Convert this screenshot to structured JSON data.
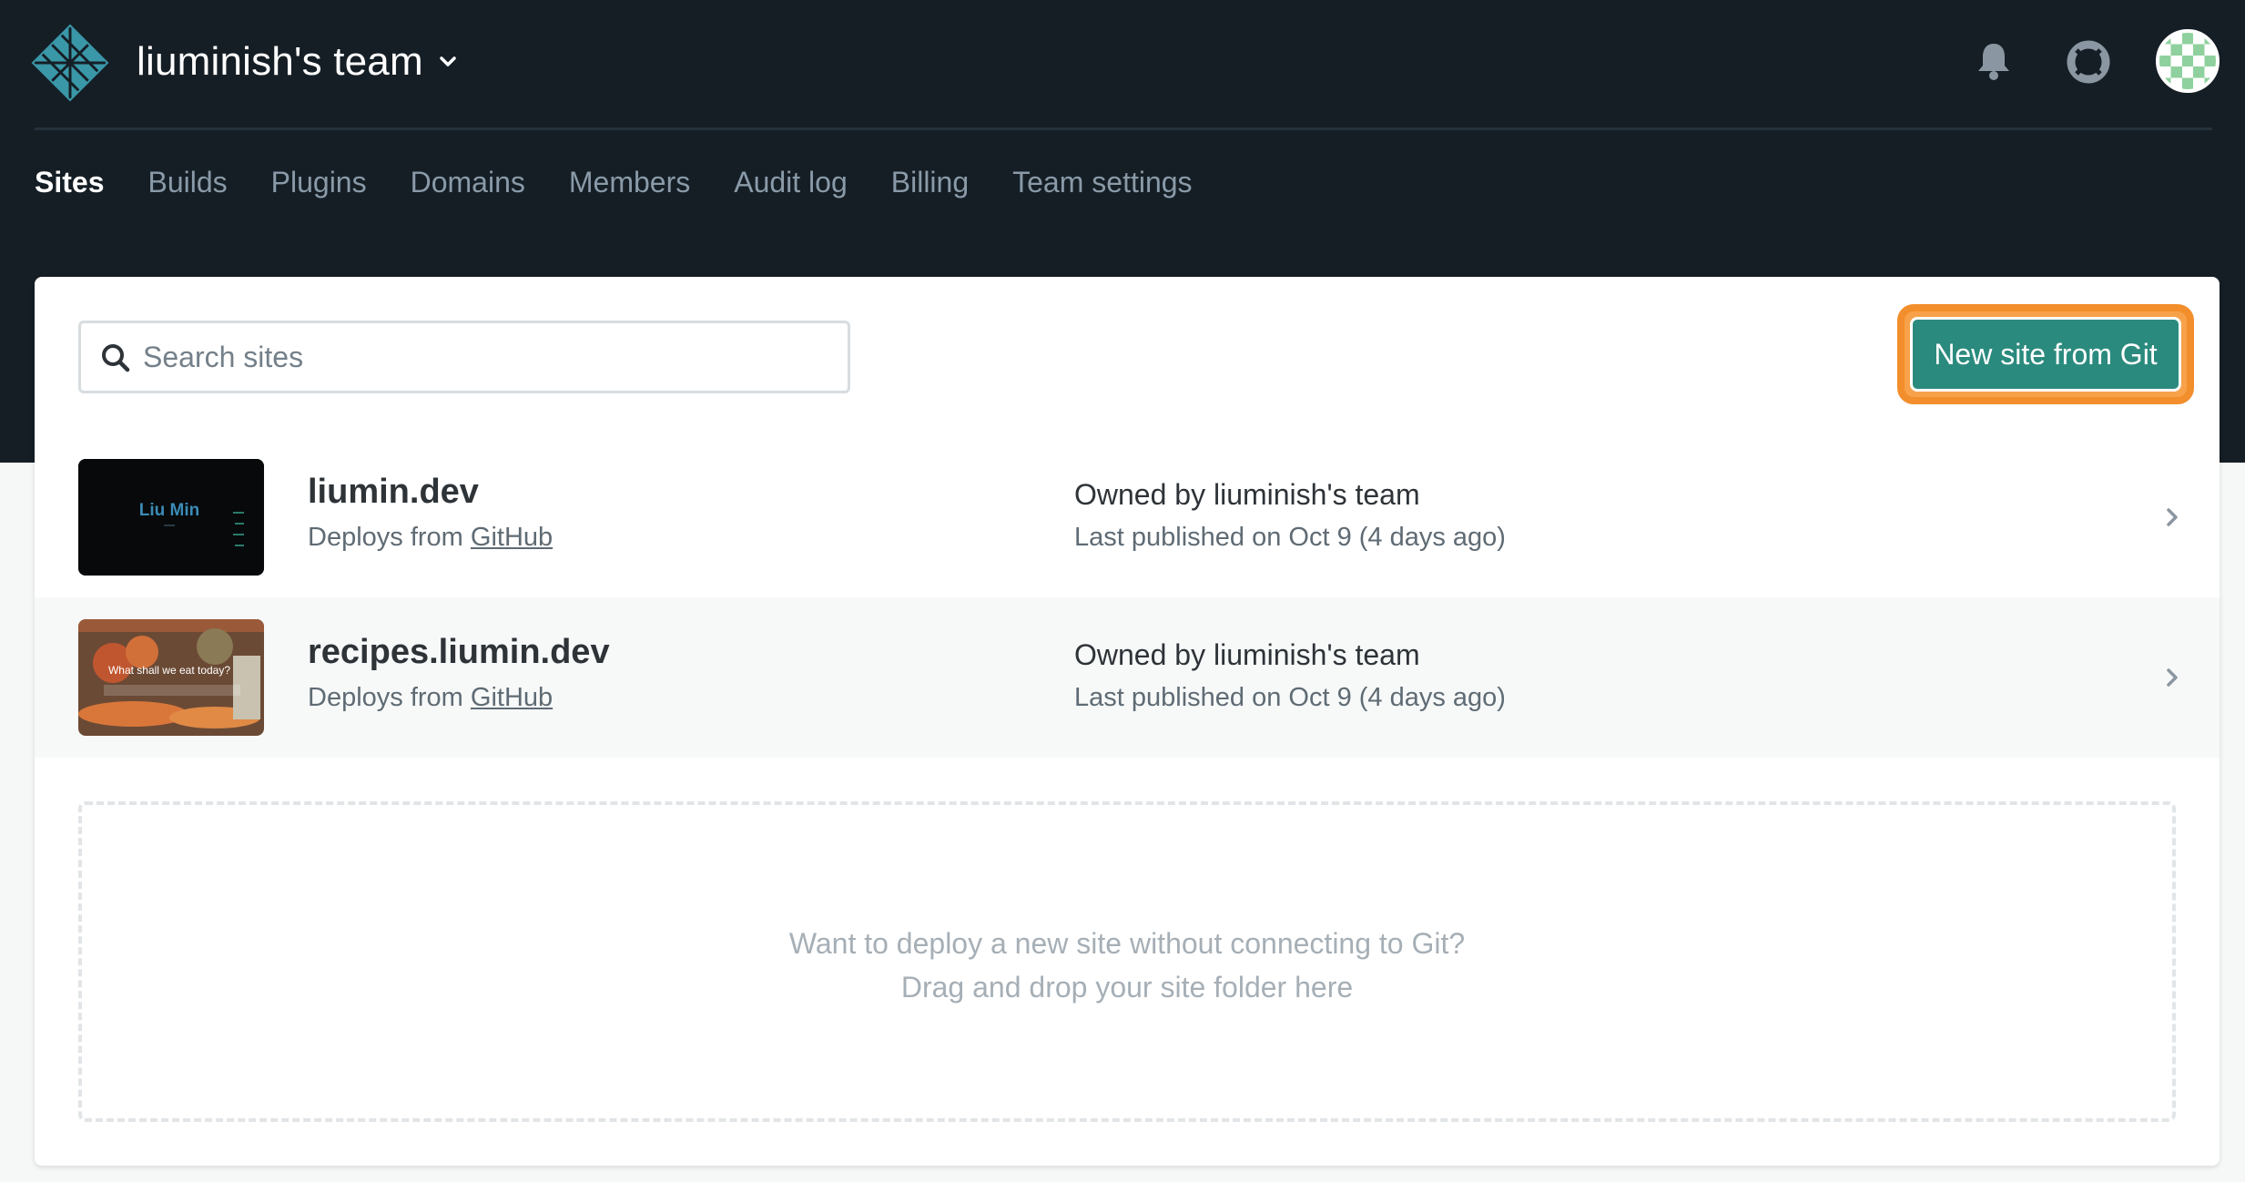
{
  "header": {
    "team_name": "liuminish's team"
  },
  "nav": {
    "tabs": [
      {
        "label": "Sites",
        "active": true
      },
      {
        "label": "Builds",
        "active": false
      },
      {
        "label": "Plugins",
        "active": false
      },
      {
        "label": "Domains",
        "active": false
      },
      {
        "label": "Members",
        "active": false
      },
      {
        "label": "Audit log",
        "active": false
      },
      {
        "label": "Billing",
        "active": false
      },
      {
        "label": "Team settings",
        "active": false
      }
    ]
  },
  "search": {
    "placeholder": "Search sites",
    "value": ""
  },
  "actions": {
    "new_site_label": "New site from Git"
  },
  "sites": [
    {
      "name": "liumin.dev",
      "deploy_prefix": "Deploys from",
      "deploy_source": "GitHub",
      "owner_prefix": "Owned by",
      "owner": "liuminish's team",
      "published": "Last published on Oct 9 (4 days ago)",
      "thumbnail_text": "Liu Min"
    },
    {
      "name": "recipes.liumin.dev",
      "deploy_prefix": "Deploys from",
      "deploy_source": "GitHub",
      "owner_prefix": "Owned by",
      "owner": "liuminish's team",
      "published": "Last published on Oct 9 (4 days ago)",
      "thumbnail_text": "What shall we eat today?"
    }
  ],
  "dropzone": {
    "line1": "Want to deploy a new site without connecting to Git?",
    "line2": "Drag and drop your site folder here"
  },
  "colors": {
    "header_bg": "#151e25",
    "accent_teal": "#2b8a7e",
    "highlight_orange": "#f28e2b"
  },
  "icons": {
    "logo": "netlify-logo",
    "team_dropdown": "chevron-down-icon",
    "notifications": "bell-icon",
    "help": "lifebuoy-icon",
    "search": "search-icon",
    "row_arrow": "chevron-right-icon"
  }
}
